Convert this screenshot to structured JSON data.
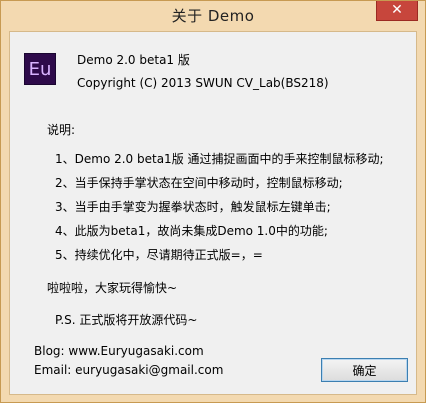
{
  "window": {
    "title": "关于 Demo",
    "close_glyph": "✕"
  },
  "app": {
    "logo_text": "Eu",
    "name_version": "Demo 2.0 beta1 版",
    "copyright": "Copyright (C) 2013 SWUN CV_Lab(BS218)"
  },
  "notes": {
    "heading": "说明:",
    "items": [
      "1、Demo 2.0 beta1版 通过捕捉画面中的手来控制鼠标移动;",
      "2、当手保持手掌状态在空间中移动时，控制鼠标移动;",
      "3、当手由手掌变为握拳状态时，触发鼠标左键单击;",
      "4、此版为beta1，故尚未集成Demo 1.0中的功能;",
      "5、持续优化中，尽请期待正式版=，="
    ],
    "greeting": "啦啦啦，大家玩得愉快~",
    "ps": "P.S. 正式版将开放源代码~"
  },
  "contact": {
    "blog": "Blog: www.Euryugasaki.com",
    "email": "Email: euryugasaki@gmail.com"
  },
  "buttons": {
    "ok_label": "确定"
  },
  "colors": {
    "frame": "#f3d9b0",
    "close_button": "#c7463c",
    "logo_background": "#2e0a4a",
    "logo_text": "#d9b3ff",
    "ok_border": "#3c7fb1"
  }
}
